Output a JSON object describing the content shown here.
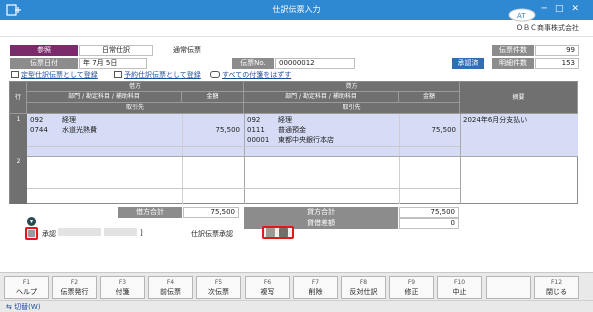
{
  "window": {
    "title": "仕訳伝票入力",
    "company": "ＯＢＣ商事株式会社"
  },
  "header": {
    "ref_label": "参照",
    "entry_type": "日常仕訳",
    "ticket_type": "通常伝票",
    "date_label": "伝票日付",
    "date_value": "年  7月  5日",
    "no_label": "伝票No.",
    "no_value": "00000012",
    "approved_badge": "承認済",
    "count_label": "伝票件数",
    "count_value": "99",
    "detail_count_label": "明細件数",
    "detail_count_value": "153"
  },
  "links": {
    "register_template": "定型仕訳伝票として登録",
    "register_scheduled": "予約仕訳伝票として登録",
    "remove_attachments": "すべての付箋をはずす"
  },
  "grid": {
    "row_header": "行",
    "debit_header": "借方",
    "credit_header": "貸方",
    "dept_account_header": "部門 / 勘定科目 / 補助科目",
    "amount_header": "金額",
    "client_header": "取引先",
    "memo_header": "摘要",
    "rows": [
      {
        "no": "1",
        "debit_dept": "092",
        "debit_dept_name": "経理",
        "debit_account": "0744",
        "debit_account_name": "水道光熱費",
        "debit_amount": "75,500",
        "credit_dept": "092",
        "credit_dept_name": "経理",
        "credit_account": "0111",
        "credit_account_name": "普通預金",
        "credit_sub": "00001",
        "credit_sub_name": "東都中央銀行本店",
        "credit_amount": "75,500",
        "memo": "2024年6月分支払い"
      },
      {
        "no": "2"
      }
    ]
  },
  "totals": {
    "debit_total_label": "借方合計",
    "debit_total": "75,500",
    "credit_total_label": "貸方合計",
    "credit_total": "75,500",
    "diff_label": "貸借差額",
    "diff": "0"
  },
  "approval": {
    "label": "承認",
    "bracket": "]",
    "journal_approval": "仕訳伝票承認"
  },
  "fkeys": [
    {
      "key": "F1",
      "label": "ヘルプ"
    },
    {
      "key": "F2",
      "label": "伝票発行"
    },
    {
      "key": "F3",
      "label": "付箋"
    },
    {
      "key": "F4",
      "label": "前伝票"
    },
    {
      "key": "F5",
      "label": "次伝票"
    },
    {
      "key": "F6",
      "label": "複写"
    },
    {
      "key": "F7",
      "label": "削除"
    },
    {
      "key": "F8",
      "label": "反対仕訳"
    },
    {
      "key": "F9",
      "label": "修正"
    },
    {
      "key": "F10",
      "label": "中止"
    },
    {
      "key": "",
      "label": ""
    },
    {
      "key": "F12",
      "label": "閉じる"
    }
  ],
  "status": {
    "switch_label": "切替(W)"
  },
  "colors": {
    "titlebar": "#2f88d2",
    "selected_row": "#d6dcf5",
    "highlight": "#e01919"
  }
}
